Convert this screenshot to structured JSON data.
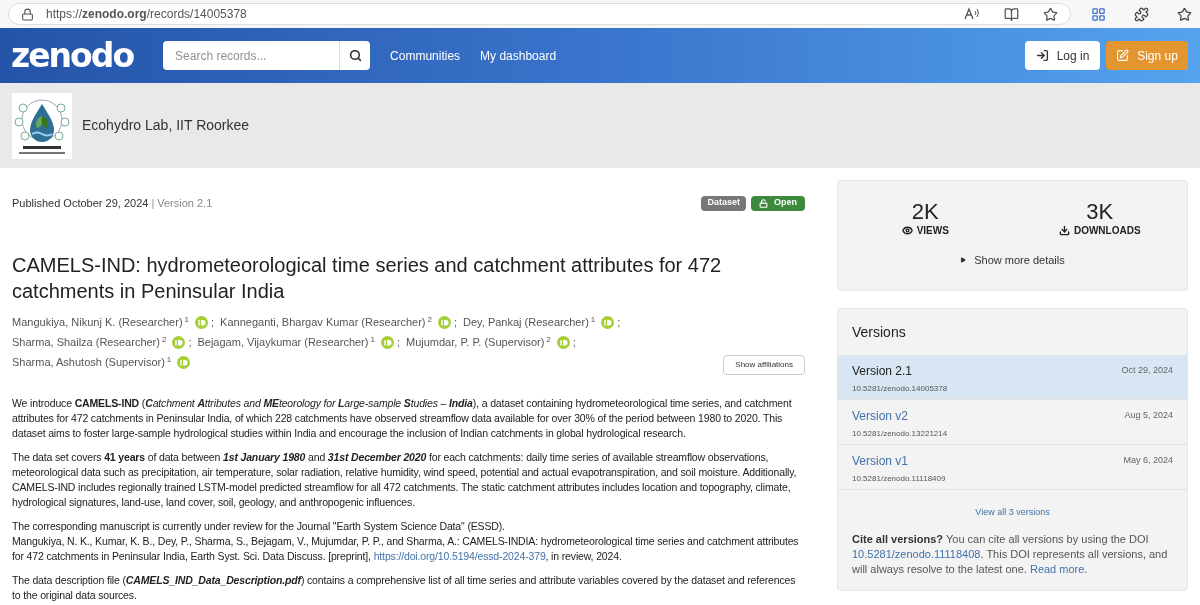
{
  "browser": {
    "url": "https://**zenodo.org**/records/14005378"
  },
  "header": {
    "logo": "zenodo",
    "search": {
      "placeholder": "Search records..."
    },
    "nav": [
      "Communities",
      "My dashboard"
    ],
    "login": "Log in",
    "signup": "Sign up"
  },
  "community": {
    "name": "Ecohydro Lab, IIT Roorkee"
  },
  "record": {
    "published": "Published October 29, 2024",
    "version": "Version 2.1",
    "version_divider": "|",
    "badges": [
      {
        "label": "Dataset",
        "kind": "type"
      },
      {
        "label": "Open",
        "kind": "access"
      }
    ],
    "title": "CAMELS-IND: hydrometeorological time series and catchment attributes for 472 catchments in Peninsular India",
    "author_lines": [
      [
        {
          "name": "Mangukiya, Nikunj K. (Researcher)",
          "affiliation": "1"
        },
        {
          "name": "Kanneganti, Bhargav Kumar (Researcher)",
          "affiliation": "2"
        },
        {
          "name": "Dey, Pankaj (Researcher)",
          "affiliation": "1"
        }
      ],
      [
        {
          "name": "Sharma, Shailza (Researcher)",
          "affiliation": "2"
        },
        {
          "name": "Bejagam, Vijaykumar (Researcher)",
          "affiliation": "1"
        },
        {
          "name": "Mujumdar, P. P. (Supervisor)",
          "affiliation": "2"
        }
      ],
      [
        {
          "name": "Sharma, Ashutosh (Supervisor)",
          "affiliation": "1"
        }
      ]
    ],
    "author_separator": ";",
    "show_affiliations": "Show affiliations",
    "description": [
      {
        "kind": "runs",
        "runs": [
          {
            "kind": "plain",
            "text": "We introduce **CAMELS-IND** ("
          },
          {
            "kind": "italic",
            "text": "**C**atchment **A**ttributes and **ME**teorology for **L**arge-sample **S**tudies – **India**"
          },
          {
            "kind": "plain",
            "text": "), a dataset containing hydrometeorological time series, and catchment attributes for 472 catchments in Peninsular India, of which 228 catchments have observed streamflow data available for over 30% of the period between 1980 to 2020. This dataset aims to foster large-sample hydrological studies within India and encourage the inclusion of Indian catchments in global hydrological research."
          }
        ]
      },
      {
        "kind": "runs",
        "runs": [
          {
            "kind": "plain",
            "text": "The data set covers **41 years** of data between "
          },
          {
            "kind": "italic",
            "text": "**1st January 1980**"
          },
          {
            "kind": "plain",
            "text": " and "
          },
          {
            "kind": "italic",
            "text": "**31st December 2020**"
          },
          {
            "kind": "plain",
            "text": " for each catchments: daily time series of available streamflow observations, meteorological data such as precipitation, air temperature, solar radiation, relative humidity, wind speed, potential and actual evapotranspiration, and soil moisture. Additionally, CAMELS-IND includes regionally trained LSTM-model predicted streamflow for all 472 catchments. The static catchment attributes includes location and topography, climate, hydrological signatures, land-use, land cover, soil, geology, and anthropogenic influences."
          }
        ]
      },
      {
        "kind": "citation",
        "note": "The corresponding manuscript is currently under review for the Journal \"Earth System Science Data\" (ESSD).",
        "before": "Mangukiya, N. K., Kumar, K. B., Dey, P., Sharma, S., Bejagam, V., Mujumdar, P. P., and Sharma, A.: CAMELS-INDIA: hydrometeorological time series and catchment attributes for 472 catchments in Peninsular India, Earth Syst. Sci. Data Discuss. [preprint],",
        "link": "https://doi.org/10.5194/essd-2024-379",
        "after": ", in review, 2024."
      },
      {
        "kind": "runs",
        "runs": [
          {
            "kind": "plain",
            "text": "The data description file ("
          },
          {
            "kind": "italic",
            "text": "**CAMELS_IND_Data_Description.pdf**"
          },
          {
            "kind": "plain",
            "text": ") contains a comprehensive list of all time series and attribute variables covered by the dataset and references to the original data sources."
          }
        ]
      }
    ]
  },
  "stats": {
    "items": [
      {
        "value": "2K",
        "label": "VIEWS",
        "kind": "views"
      },
      {
        "value": "3K",
        "label": "DOWNLOADS",
        "kind": "downloads"
      }
    ],
    "details": "Show more details"
  },
  "versions": {
    "title": "Versions",
    "items": [
      {
        "name": "Version 2.1",
        "doi": "10.5281/zenodo.14005378",
        "date": "Oct 29, 2024",
        "selected": true
      },
      {
        "name": "Version v2",
        "doi": "10.5281/zenodo.13221214",
        "date": "Aug 5, 2024",
        "selected": false
      },
      {
        "name": "Version v1",
        "doi": "10.5281/zenodo.11118409",
        "date": "May 6, 2024",
        "selected": false
      }
    ],
    "view_all": "View all 3 versions",
    "cite": {
      "lead": "Cite all versions?",
      "text1": "You can cite all versions by using the DOI",
      "doi": "10.5281/zenodo.11118408",
      "text2": ". This DOI represents all versions, and will always resolve to the latest one.",
      "more": "Read more",
      "end": "."
    }
  }
}
